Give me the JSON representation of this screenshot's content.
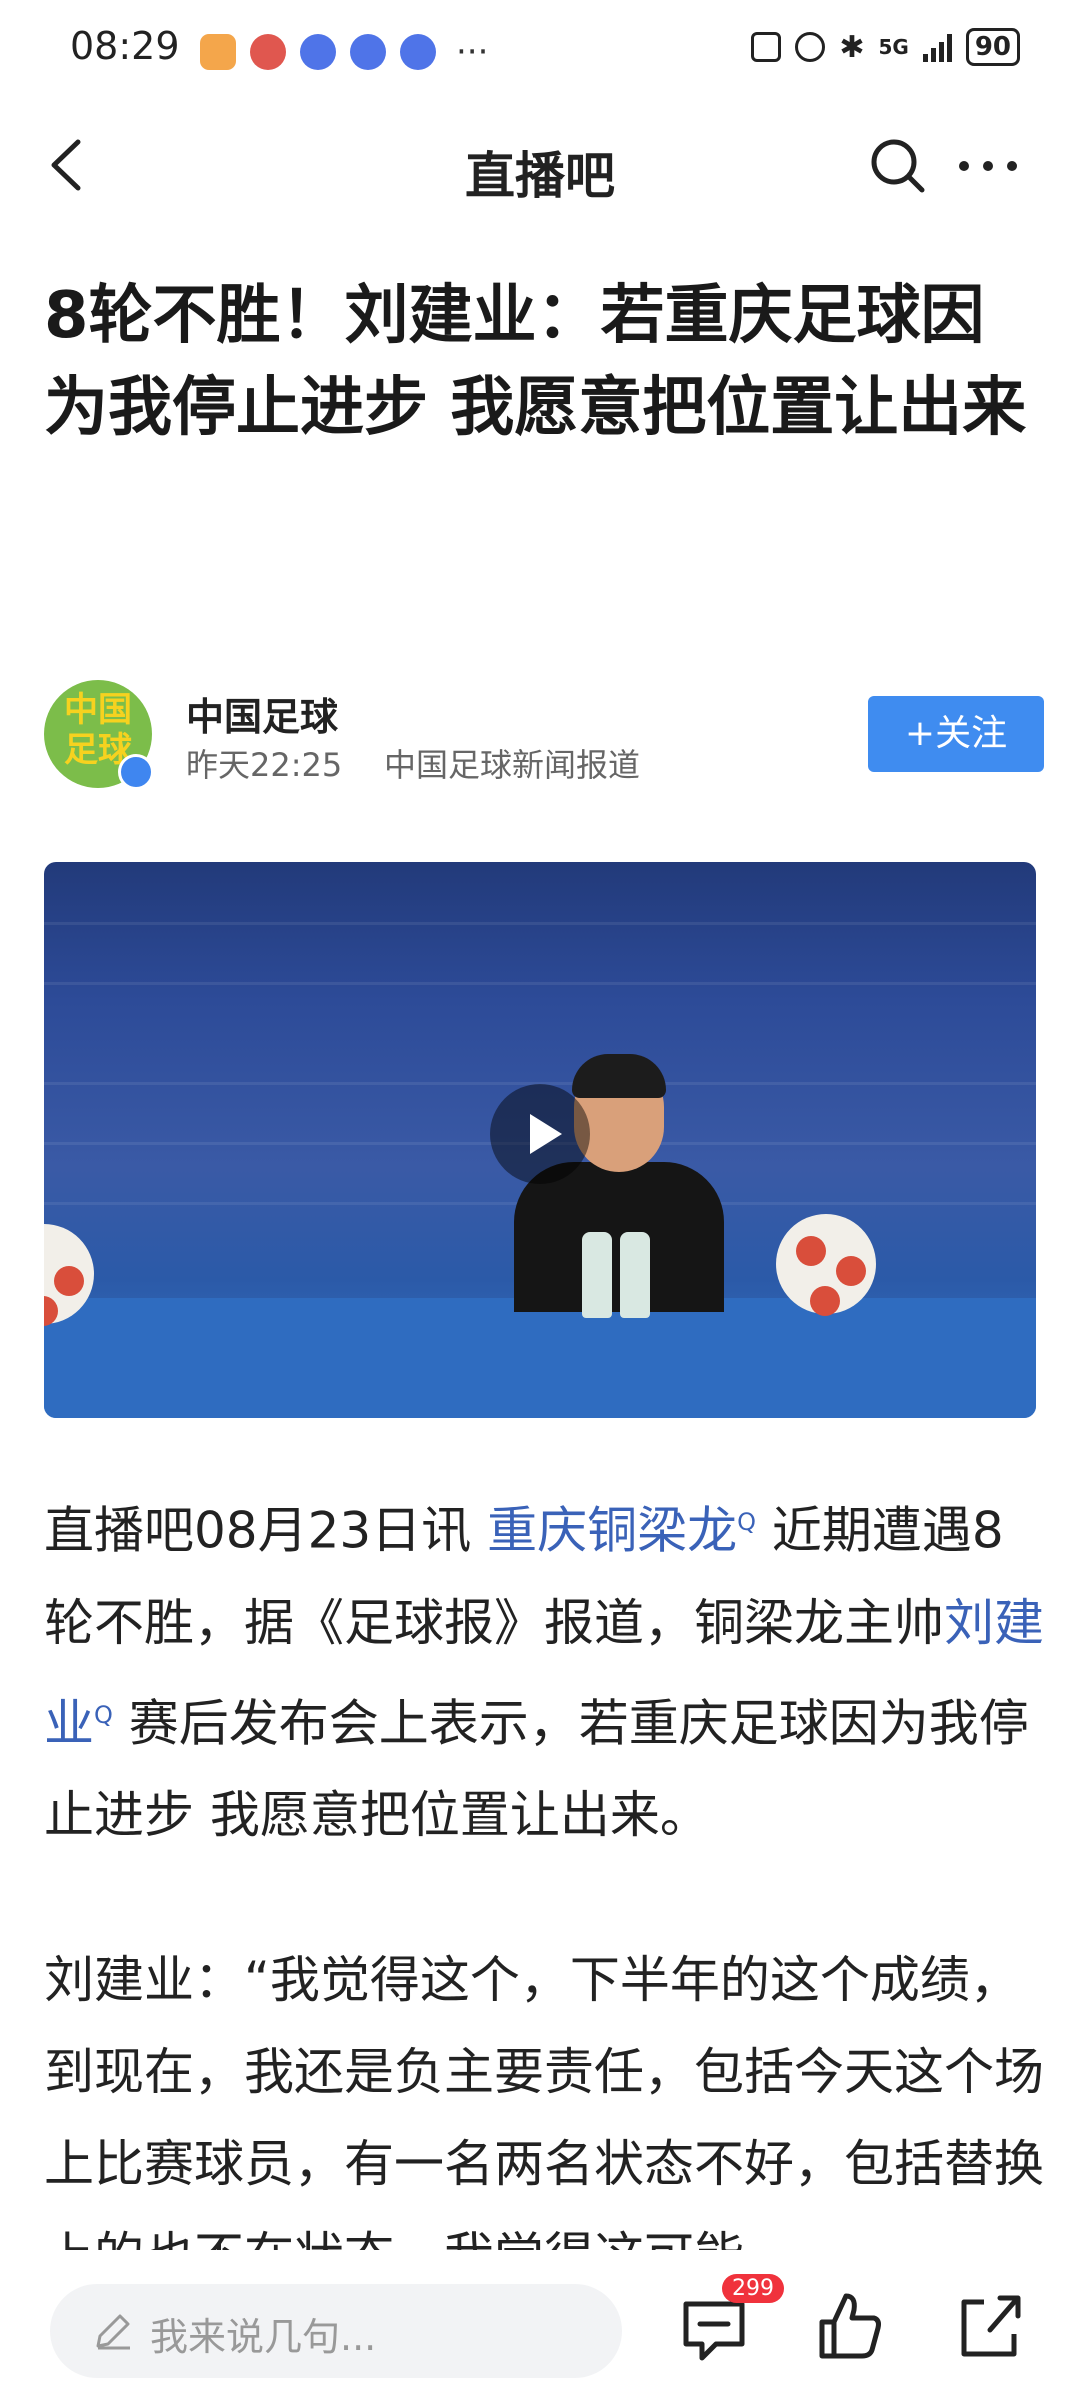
{
  "status_bar": {
    "time": "08:29",
    "network": "5G",
    "battery": "90"
  },
  "nav": {
    "title": "直播吧",
    "icons": [
      "back-icon",
      "search-icon",
      "more-icon"
    ]
  },
  "article": {
    "headline": "8轮不胜！刘建业：若重庆足球因为我停止进步 我愿意把位置让出来",
    "author": {
      "avatar_text": "中国足球",
      "name": "中国足球",
      "time": "昨天22:25",
      "source": "中国足球新闻报道",
      "follow_label": "+关注"
    },
    "paragraph1": {
      "part1": "直播吧08月23日讯 ",
      "link1": "重庆铜梁龙",
      "part2": " 近期遭遇8轮不胜，据《足球报》报道，铜梁龙主帅",
      "link2": "刘建业",
      "part3": " 赛后发布会上表示，若重庆足球因为我停止进步 我愿意把位置让出来。"
    },
    "paragraph2": "刘建业：“我觉得这个，下半年的这个成绩，到现在，我还是负主要责任，包括今天这个场上比赛球员，有一名两名状态不好，包括替换上的也不在状态，我觉得这可能"
  },
  "bottom_bar": {
    "comment_placeholder": "我来说几句...",
    "comment_count": "299"
  },
  "colors": {
    "accent": "#3f8cf0",
    "link": "#3a62b8",
    "badge": "#f0323c"
  }
}
